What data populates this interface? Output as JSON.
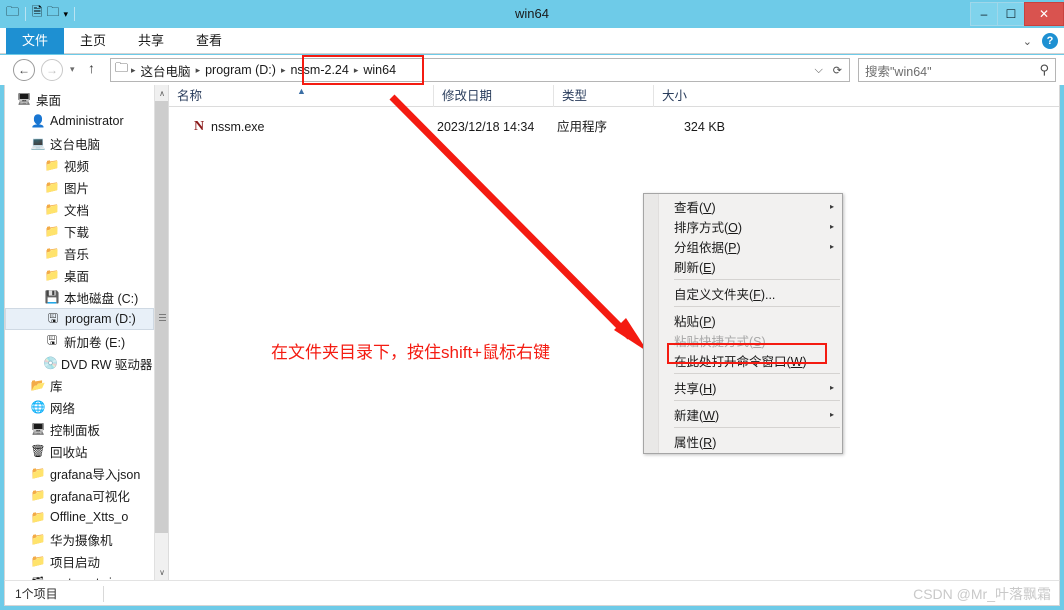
{
  "window": {
    "title": "win64",
    "quick_access": [
      {
        "name": "folder-icon",
        "glyph": "📁"
      },
      {
        "name": "properties-icon",
        "glyph": "🗎"
      },
      {
        "name": "new-folder-icon",
        "glyph": "📁"
      },
      {
        "name": "qat-dropdown-icon",
        "glyph": "▾"
      }
    ],
    "controls": {
      "minimize": "–",
      "maximize": "☐",
      "close": "✕"
    }
  },
  "ribbon": {
    "tabs": [
      {
        "label": "文件",
        "active": true
      },
      {
        "label": "主页",
        "active": false
      },
      {
        "label": "共享",
        "active": false
      },
      {
        "label": "查看",
        "active": false
      }
    ],
    "expand_icon": "⌵",
    "help_label": "?"
  },
  "navigation": {
    "back_icon": "←",
    "forward_icon": "→",
    "history_icon": "▾",
    "up_icon": "↑",
    "folder_icon": "📁",
    "breadcrumbs": [
      "这台电脑",
      "program (D:)",
      "nssm-2.24",
      "win64"
    ],
    "separator": "▸",
    "dropdown_icon": "⌵",
    "refresh_icon": "⟳"
  },
  "search": {
    "placeholder": "搜索\"win64\"",
    "icon": "⚲"
  },
  "sidebar": {
    "items": [
      {
        "label": "桌面",
        "icon": "🖥",
        "indent": 0,
        "selected": false
      },
      {
        "label": "Administrator",
        "icon": "👤",
        "indent": 1,
        "selected": false
      },
      {
        "label": "这台电脑",
        "icon": "💻",
        "indent": 1,
        "selected": false
      },
      {
        "label": "视频",
        "icon": "📁",
        "indent": 2,
        "selected": false
      },
      {
        "label": "图片",
        "icon": "📁",
        "indent": 2,
        "selected": false
      },
      {
        "label": "文档",
        "icon": "📁",
        "indent": 2,
        "selected": false
      },
      {
        "label": "下载",
        "icon": "📁",
        "indent": 2,
        "selected": false
      },
      {
        "label": "音乐",
        "icon": "📁",
        "indent": 2,
        "selected": false
      },
      {
        "label": "桌面",
        "icon": "📁",
        "indent": 2,
        "selected": false
      },
      {
        "label": "本地磁盘 (C:)",
        "icon": "💾",
        "indent": 2,
        "selected": false
      },
      {
        "label": "program (D:)",
        "icon": "🖫",
        "indent": 2,
        "selected": true
      },
      {
        "label": "新加卷 (E:)",
        "icon": "🖫",
        "indent": 2,
        "selected": false
      },
      {
        "label": "DVD RW 驱动器 (G",
        "icon": "💿",
        "indent": 2,
        "selected": false
      },
      {
        "label": "库",
        "icon": "📂",
        "indent": 1,
        "selected": false
      },
      {
        "label": "网络",
        "icon": "🌐",
        "indent": 1,
        "selected": false
      },
      {
        "label": "控制面板",
        "icon": "🖥",
        "indent": 1,
        "selected": false
      },
      {
        "label": "回收站",
        "icon": "🗑",
        "indent": 1,
        "selected": false
      },
      {
        "label": "grafana导入json",
        "icon": "📁",
        "indent": 1,
        "selected": false
      },
      {
        "label": "grafana可视化",
        "icon": "📁",
        "indent": 1,
        "selected": false
      },
      {
        "label": "Offline_Xtts_o",
        "icon": "📁",
        "indent": 1,
        "selected": false
      },
      {
        "label": "华为摄像机",
        "icon": "📁",
        "indent": 1,
        "selected": false
      },
      {
        "label": "项目启动",
        "icon": "📁",
        "indent": 1,
        "selected": false
      },
      {
        "label": "root_cert.zip",
        "icon": "🗃",
        "indent": 1,
        "selected": false
      }
    ],
    "scroll_up_icon": "∧",
    "scroll_down_icon": "∨"
  },
  "filelist": {
    "columns": [
      {
        "label": "名称",
        "sorted": true
      },
      {
        "label": "修改日期",
        "sorted": false
      },
      {
        "label": "类型",
        "sorted": false
      },
      {
        "label": "大小",
        "sorted": false
      }
    ],
    "sort_arrow": "▲",
    "rows": [
      {
        "icon": "N",
        "name": "nssm.exe",
        "modified": "2023/12/18 14:34",
        "type": "应用程序",
        "size": "324 KB"
      }
    ]
  },
  "context_menu": {
    "items": [
      {
        "label": "查看(V)",
        "accel": "V",
        "submenu": true,
        "disabled": false,
        "highlighted": false
      },
      {
        "label": "排序方式(O)",
        "accel": "O",
        "submenu": true,
        "disabled": false,
        "highlighted": false
      },
      {
        "label": "分组依据(P)",
        "accel": "P",
        "submenu": true,
        "disabled": false,
        "highlighted": false
      },
      {
        "label": "刷新(E)",
        "accel": "E",
        "submenu": false,
        "disabled": false,
        "highlighted": false
      },
      {
        "separator": true
      },
      {
        "label": "自定义文件夹(F)...",
        "accel": "F",
        "submenu": false,
        "disabled": false,
        "highlighted": false
      },
      {
        "separator": true
      },
      {
        "label": "粘贴(P)",
        "accel": "P",
        "submenu": false,
        "disabled": false,
        "highlighted": false
      },
      {
        "label": "粘贴快捷方式(S)",
        "accel": "S",
        "submenu": false,
        "disabled": true,
        "highlighted": false
      },
      {
        "label": "在此处打开命令窗口(W)",
        "accel": "W",
        "submenu": false,
        "disabled": false,
        "highlighted": true
      },
      {
        "separator": true
      },
      {
        "label": "共享(H)",
        "accel": "H",
        "submenu": true,
        "disabled": false,
        "highlighted": false
      },
      {
        "separator": true
      },
      {
        "label": "新建(W)",
        "accel": "W",
        "submenu": true,
        "disabled": false,
        "highlighted": false
      },
      {
        "separator": true
      },
      {
        "label": "属性(R)",
        "accel": "R",
        "submenu": false,
        "disabled": false,
        "highlighted": false
      }
    ],
    "submenu_arrow": "▸"
  },
  "annotations": {
    "instruction_text": "在文件夹目录下，按住shift+鼠标右键",
    "highlight_color": "#f41b11"
  },
  "statusbar": {
    "item_count": "1个项目",
    "watermark": "CSDN @Mr_叶落飘霜"
  }
}
